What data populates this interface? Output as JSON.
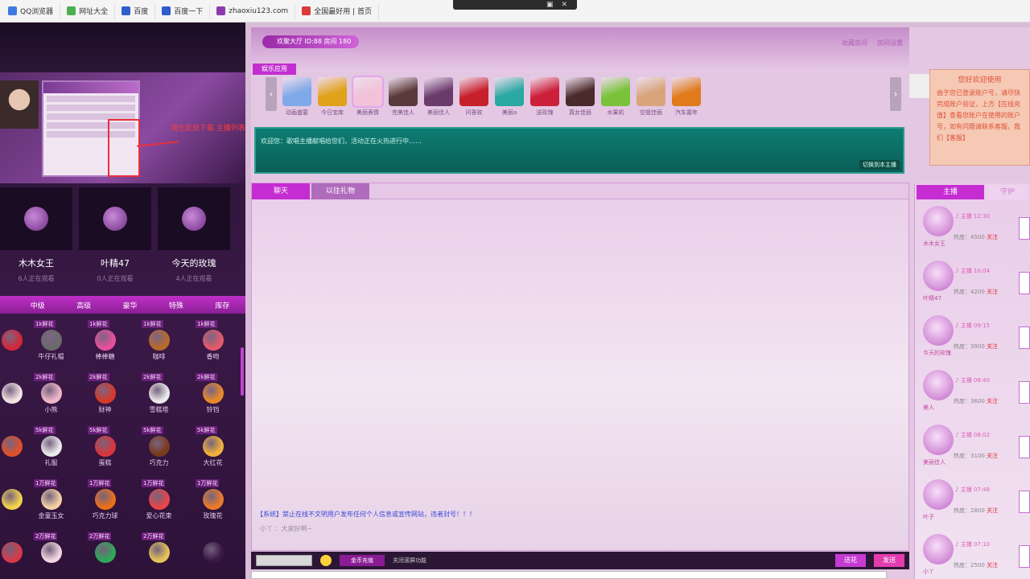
{
  "browser": {
    "bookmarks": [
      {
        "label": "QQ浏览器",
        "icon": "browser-icon",
        "color": "#3b7be3"
      },
      {
        "label": "网址大全",
        "icon": "green-leaf-icon",
        "color": "#4caf50"
      },
      {
        "label": "百度",
        "icon": "paw-icon",
        "color": "#2f5ecb"
      },
      {
        "label": "百度一下",
        "icon": "search-icon",
        "color": "#2f5ecb"
      },
      {
        "label": "zhaoxiu123.com",
        "icon": "site-icon",
        "color": "#8e3ab0"
      },
      {
        "label": "全国最好用 | 首页",
        "icon": "flag-icon",
        "color": "#d93a3a"
      }
    ]
  },
  "left": {
    "hint_text": "请在此处下载 主播列表",
    "anchors": [
      {
        "name": "木木女王",
        "sub": "6人正在观看"
      },
      {
        "name": "叶精47",
        "sub": "0人正在观看"
      },
      {
        "name": "今天的玫瑰",
        "sub": "4人正在观看"
      }
    ],
    "gift_tabs": [
      "中级",
      "高级",
      "豪华",
      "特殊",
      "库存"
    ],
    "gifts": [
      {
        "price": "",
        "name": "",
        "color": "#d4283a"
      },
      {
        "price": "1k鲜花",
        "name": "牛仔礼帽",
        "color": "#6a6a6a"
      },
      {
        "price": "1k鲜花",
        "name": "棒棒糖",
        "color": "#e84f9a"
      },
      {
        "price": "1k鲜花",
        "name": "咖啡",
        "color": "#b86a2a"
      },
      {
        "price": "1k鲜花",
        "name": "香吻",
        "color": "#e25a6a"
      },
      {
        "price": "",
        "name": "",
        "color": "#f3e2e2"
      },
      {
        "price": "2k鲜花",
        "name": "小熊",
        "color": "#f0b6c8"
      },
      {
        "price": "2k鲜花",
        "name": "财神",
        "color": "#d63a2a"
      },
      {
        "price": "2k鲜花",
        "name": "雪糕塔",
        "color": "#eaeaea"
      },
      {
        "price": "2k鲜花",
        "name": "铃铛",
        "color": "#e88a2a"
      },
      {
        "price": "",
        "name": "",
        "color": "#e0502a"
      },
      {
        "price": "5k鲜花",
        "name": "礼服",
        "color": "#ebebeb"
      },
      {
        "price": "5k鲜花",
        "name": "蛋糕",
        "color": "#d8353a"
      },
      {
        "price": "5k鲜花",
        "name": "巧克力",
        "color": "#7a3a1a"
      },
      {
        "price": "5k鲜花",
        "name": "大红花",
        "color": "#f2b13a"
      },
      {
        "price": "",
        "name": "",
        "color": "#f2d24a"
      },
      {
        "price": "1万鲜花",
        "name": "金童玉女",
        "color": "#f4d0a4"
      },
      {
        "price": "1万鲜花",
        "name": "巧克力球",
        "color": "#ec6f1a"
      },
      {
        "price": "1万鲜花",
        "name": "爱心花束",
        "color": "#e8454a"
      },
      {
        "price": "1万鲜花",
        "name": "玫瑰花",
        "color": "#ea7a2a"
      },
      {
        "price": "",
        "name": "",
        "color": "#d63a4a"
      },
      {
        "price": "2万鲜花",
        "name": "",
        "color": "#f4d4e0"
      },
      {
        "price": "2万鲜花",
        "name": "",
        "color": "#2fa85a"
      },
      {
        "price": "2万鲜花",
        "name": "",
        "color": "#e5c25a"
      },
      {
        "price": "",
        "name": "",
        "color": "#3a1846"
      }
    ]
  },
  "main": {
    "room_title": "欢聚大厅 ID:88 房间 180",
    "room_links": [
      "收藏房间",
      "房间设置"
    ],
    "pin_tag": "娱乐应用",
    "apps": [
      {
        "label": "动画盛宴",
        "color": "#7fa8e8"
      },
      {
        "label": "今日宝库",
        "color": "#e0a21a"
      },
      {
        "label": "美丽表情",
        "color": "#f1c2d8"
      },
      {
        "label": "完美佳人",
        "color": "#5a3a3a"
      },
      {
        "label": "美丽佳人",
        "color": "#6a3a6a"
      },
      {
        "label": "问答玫",
        "color": "#c8202a"
      },
      {
        "label": "美丽a",
        "color": "#2aa8a2"
      },
      {
        "label": "送玫瑰",
        "color": "#cc1f3a"
      },
      {
        "label": "真女佳丽",
        "color": "#4a2a2a"
      },
      {
        "label": "水果机",
        "color": "#7ac23a"
      },
      {
        "label": "空姐佳丽",
        "color": "#d8a47a"
      },
      {
        "label": "汽车嘉年",
        "color": "#e07a1a"
      }
    ],
    "notice": {
      "title": "您好欢迎使用",
      "body": "由于您已登录账户号，请尽快完成账户验证，上方【在线充值】查看您账户在使用的账户号，如有问题请联系客服，我们【客服】"
    },
    "marquee_text": "欢迎您：歌唱主播献唱给您们，活动正在火热进行中……",
    "marquee_button": "切换到本主播",
    "chat_tabs": [
      "聊天",
      "以往礼物"
    ],
    "system_message": "【系统】禁止在线不文明用户发布任何个人信息或宣传网站，违者封号！！！",
    "system_message2": "小丫 ：大家好啊~",
    "bottom_gold_label": "金币充值",
    "bottom_option": "关闭滚屏功能",
    "send_button": "发送",
    "flower_button": "送花"
  },
  "right": {
    "tabs": [
      "主播",
      "守护"
    ],
    "users": [
      {
        "name": "木木女王",
        "info": "♪ 主播 12:30",
        "stat_label": "热度：4500",
        "stat_flag": "关注"
      },
      {
        "name": "叶精47",
        "info": "♪ 主播 10:04",
        "stat_label": "热度：4200",
        "stat_flag": "关注"
      },
      {
        "name": "今天的玫瑰",
        "info": "♪ 主播 09:15",
        "stat_label": "热度：3900",
        "stat_flag": "关注"
      },
      {
        "name": "美人",
        "info": "♪ 主播 08:40",
        "stat_label": "热度：3600",
        "stat_flag": "关注"
      },
      {
        "name": "美丽佳人",
        "info": "♪ 主播 08:02",
        "stat_label": "热度：3100",
        "stat_flag": "关注"
      },
      {
        "name": "叶子",
        "info": "♪ 主播 07:48",
        "stat_label": "热度：2800",
        "stat_flag": "关注"
      },
      {
        "name": "小丫",
        "info": "♪ 主播 07:10",
        "stat_label": "热度：2500",
        "stat_flag": "关注"
      }
    ]
  },
  "colors": {
    "accent": "#c52cd2",
    "teal": "#0e7d73",
    "sidebar_dark": "#2a1535"
  }
}
